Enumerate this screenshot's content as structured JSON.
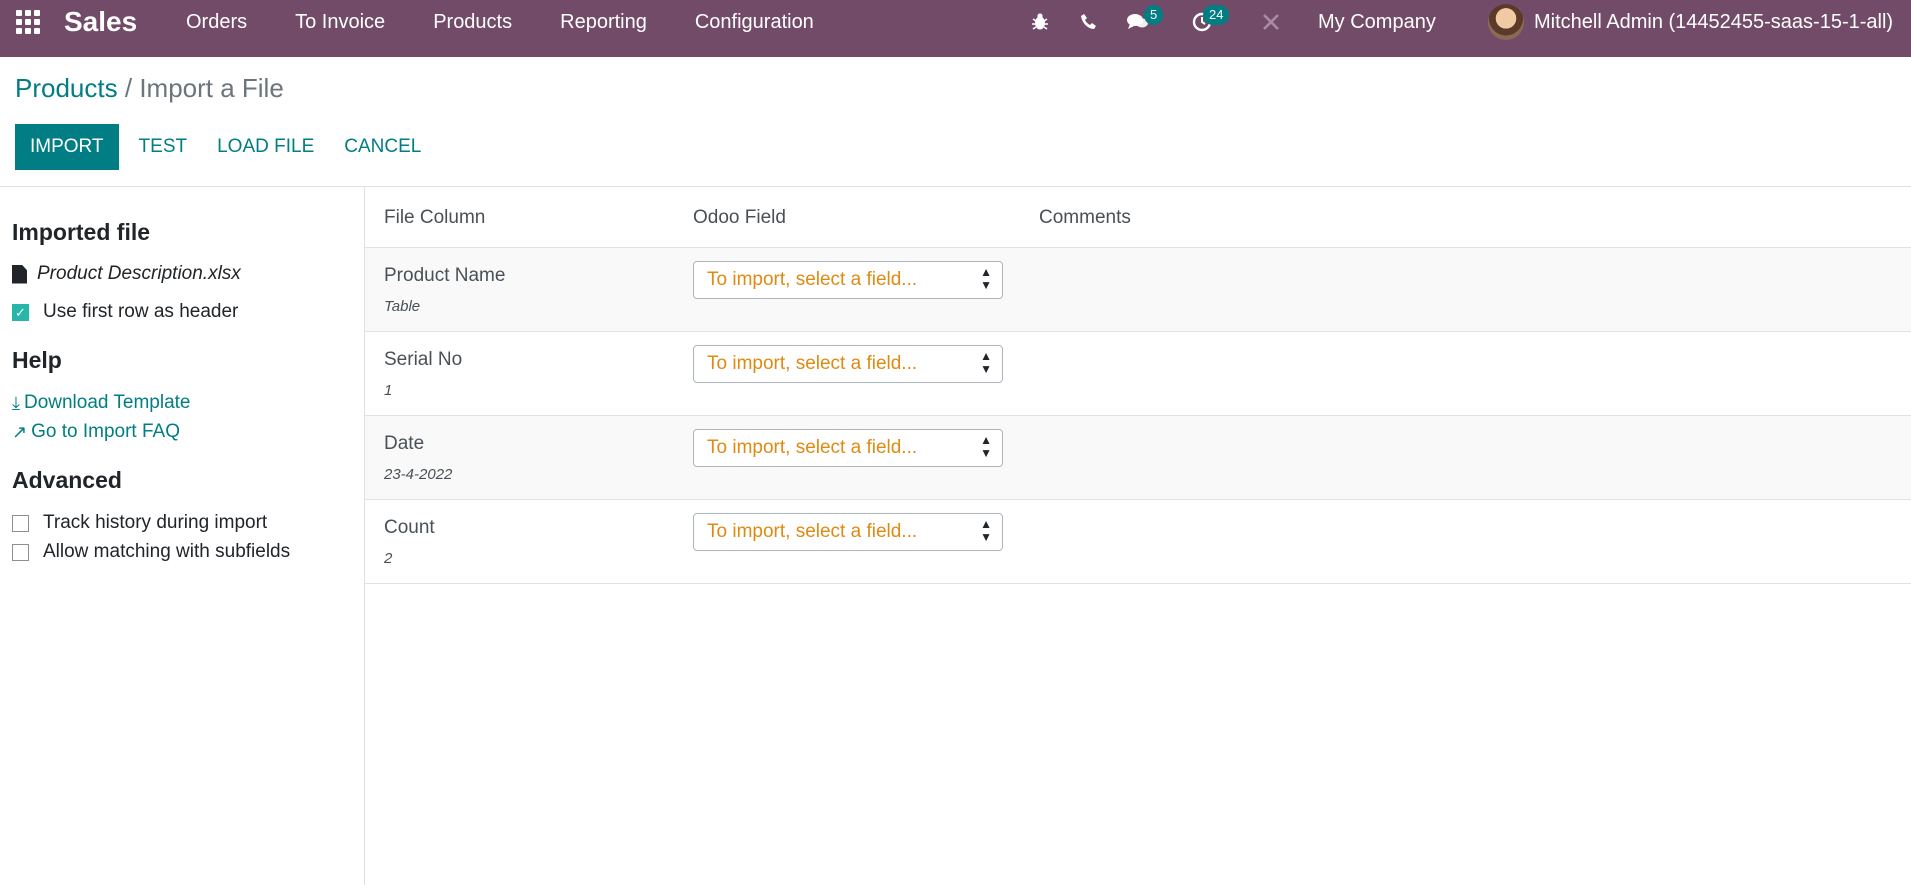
{
  "navbar": {
    "app_name": "Sales",
    "menu": [
      "Orders",
      "To Invoice",
      "Products",
      "Reporting",
      "Configuration"
    ],
    "messages_count": "5",
    "activities_count": "24",
    "company": "My Company",
    "user": "Mitchell Admin (14452455-saas-15-1-all)"
  },
  "breadcrumb": {
    "parent": "Products",
    "separator": "/",
    "current": "Import a File"
  },
  "buttons": {
    "import": "Import",
    "test": "Test",
    "load_file": "Load File",
    "cancel": "Cancel"
  },
  "sidebar": {
    "imported_file_heading": "Imported file",
    "file_name": "Product Description.xlsx",
    "first_row_header_label": "Use first row as header",
    "first_row_header_checked": true,
    "help_heading": "Help",
    "download_template": "Download Template",
    "import_faq": "Go to Import FAQ",
    "advanced_heading": "Advanced",
    "track_history_label": "Track history during import",
    "track_history_checked": false,
    "allow_matching_label": "Allow matching with subfields",
    "allow_matching_checked": false
  },
  "table": {
    "headers": {
      "file_column": "File Column",
      "odoo_field": "Odoo Field",
      "comments": "Comments"
    },
    "select_placeholder": "To import, select a field...",
    "rows": [
      {
        "name": "Product Name",
        "sample": "Table"
      },
      {
        "name": "Serial No",
        "sample": "1"
      },
      {
        "name": "Date",
        "sample": "23-4-2022"
      },
      {
        "name": "Count",
        "sample": "2"
      }
    ]
  },
  "colors": {
    "navbar": "#714b67",
    "accent": "#017e84",
    "placeholder": "#e08a12",
    "checkbox": "#26b7a8"
  }
}
